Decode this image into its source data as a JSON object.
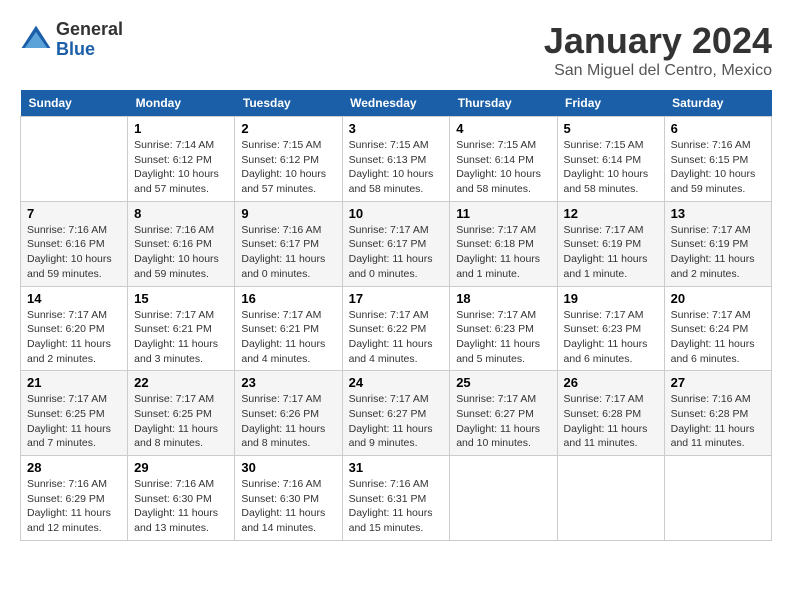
{
  "logo": {
    "general": "General",
    "blue": "Blue"
  },
  "title": "January 2024",
  "location": "San Miguel del Centro, Mexico",
  "days_of_week": [
    "Sunday",
    "Monday",
    "Tuesday",
    "Wednesday",
    "Thursday",
    "Friday",
    "Saturday"
  ],
  "weeks": [
    [
      {
        "num": "",
        "info": ""
      },
      {
        "num": "1",
        "info": "Sunrise: 7:14 AM\nSunset: 6:12 PM\nDaylight: 10 hours\nand 57 minutes."
      },
      {
        "num": "2",
        "info": "Sunrise: 7:15 AM\nSunset: 6:12 PM\nDaylight: 10 hours\nand 57 minutes."
      },
      {
        "num": "3",
        "info": "Sunrise: 7:15 AM\nSunset: 6:13 PM\nDaylight: 10 hours\nand 58 minutes."
      },
      {
        "num": "4",
        "info": "Sunrise: 7:15 AM\nSunset: 6:14 PM\nDaylight: 10 hours\nand 58 minutes."
      },
      {
        "num": "5",
        "info": "Sunrise: 7:15 AM\nSunset: 6:14 PM\nDaylight: 10 hours\nand 58 minutes."
      },
      {
        "num": "6",
        "info": "Sunrise: 7:16 AM\nSunset: 6:15 PM\nDaylight: 10 hours\nand 59 minutes."
      }
    ],
    [
      {
        "num": "7",
        "info": "Sunrise: 7:16 AM\nSunset: 6:16 PM\nDaylight: 10 hours\nand 59 minutes."
      },
      {
        "num": "8",
        "info": "Sunrise: 7:16 AM\nSunset: 6:16 PM\nDaylight: 10 hours\nand 59 minutes."
      },
      {
        "num": "9",
        "info": "Sunrise: 7:16 AM\nSunset: 6:17 PM\nDaylight: 11 hours\nand 0 minutes."
      },
      {
        "num": "10",
        "info": "Sunrise: 7:17 AM\nSunset: 6:17 PM\nDaylight: 11 hours\nand 0 minutes."
      },
      {
        "num": "11",
        "info": "Sunrise: 7:17 AM\nSunset: 6:18 PM\nDaylight: 11 hours\nand 1 minute."
      },
      {
        "num": "12",
        "info": "Sunrise: 7:17 AM\nSunset: 6:19 PM\nDaylight: 11 hours\nand 1 minute."
      },
      {
        "num": "13",
        "info": "Sunrise: 7:17 AM\nSunset: 6:19 PM\nDaylight: 11 hours\nand 2 minutes."
      }
    ],
    [
      {
        "num": "14",
        "info": "Sunrise: 7:17 AM\nSunset: 6:20 PM\nDaylight: 11 hours\nand 2 minutes."
      },
      {
        "num": "15",
        "info": "Sunrise: 7:17 AM\nSunset: 6:21 PM\nDaylight: 11 hours\nand 3 minutes."
      },
      {
        "num": "16",
        "info": "Sunrise: 7:17 AM\nSunset: 6:21 PM\nDaylight: 11 hours\nand 4 minutes."
      },
      {
        "num": "17",
        "info": "Sunrise: 7:17 AM\nSunset: 6:22 PM\nDaylight: 11 hours\nand 4 minutes."
      },
      {
        "num": "18",
        "info": "Sunrise: 7:17 AM\nSunset: 6:23 PM\nDaylight: 11 hours\nand 5 minutes."
      },
      {
        "num": "19",
        "info": "Sunrise: 7:17 AM\nSunset: 6:23 PM\nDaylight: 11 hours\nand 6 minutes."
      },
      {
        "num": "20",
        "info": "Sunrise: 7:17 AM\nSunset: 6:24 PM\nDaylight: 11 hours\nand 6 minutes."
      }
    ],
    [
      {
        "num": "21",
        "info": "Sunrise: 7:17 AM\nSunset: 6:25 PM\nDaylight: 11 hours\nand 7 minutes."
      },
      {
        "num": "22",
        "info": "Sunrise: 7:17 AM\nSunset: 6:25 PM\nDaylight: 11 hours\nand 8 minutes."
      },
      {
        "num": "23",
        "info": "Sunrise: 7:17 AM\nSunset: 6:26 PM\nDaylight: 11 hours\nand 8 minutes."
      },
      {
        "num": "24",
        "info": "Sunrise: 7:17 AM\nSunset: 6:27 PM\nDaylight: 11 hours\nand 9 minutes."
      },
      {
        "num": "25",
        "info": "Sunrise: 7:17 AM\nSunset: 6:27 PM\nDaylight: 11 hours\nand 10 minutes."
      },
      {
        "num": "26",
        "info": "Sunrise: 7:17 AM\nSunset: 6:28 PM\nDaylight: 11 hours\nand 11 minutes."
      },
      {
        "num": "27",
        "info": "Sunrise: 7:16 AM\nSunset: 6:28 PM\nDaylight: 11 hours\nand 11 minutes."
      }
    ],
    [
      {
        "num": "28",
        "info": "Sunrise: 7:16 AM\nSunset: 6:29 PM\nDaylight: 11 hours\nand 12 minutes."
      },
      {
        "num": "29",
        "info": "Sunrise: 7:16 AM\nSunset: 6:30 PM\nDaylight: 11 hours\nand 13 minutes."
      },
      {
        "num": "30",
        "info": "Sunrise: 7:16 AM\nSunset: 6:30 PM\nDaylight: 11 hours\nand 14 minutes."
      },
      {
        "num": "31",
        "info": "Sunrise: 7:16 AM\nSunset: 6:31 PM\nDaylight: 11 hours\nand 15 minutes."
      },
      {
        "num": "",
        "info": ""
      },
      {
        "num": "",
        "info": ""
      },
      {
        "num": "",
        "info": ""
      }
    ]
  ]
}
